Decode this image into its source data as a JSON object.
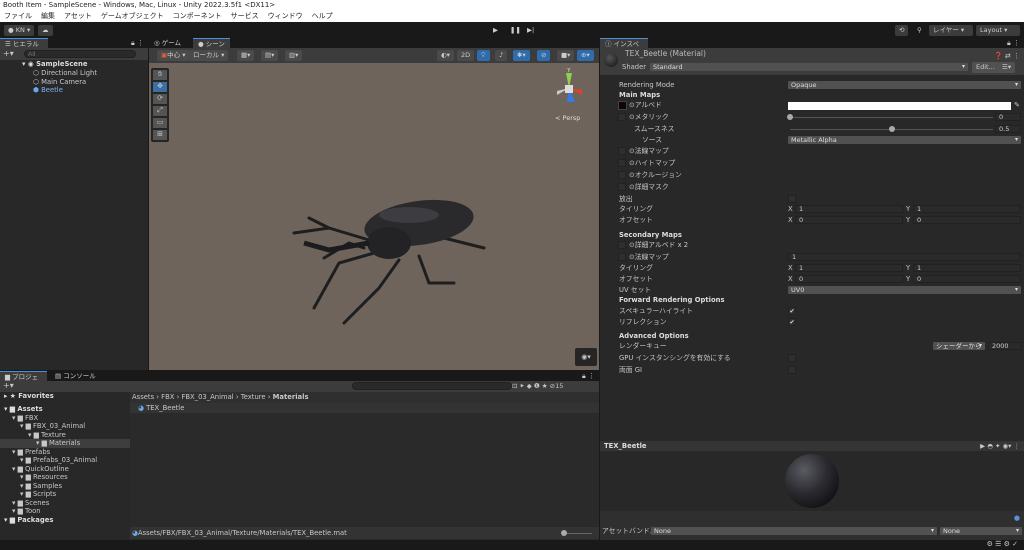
{
  "window": {
    "title": "Booth Item - SampleScene - Windows, Mac, Linux - Unity 2022.3.5f1 <DX11>"
  },
  "menu": [
    "ファイル",
    "編集",
    "アセット",
    "ゲームオブジェクト",
    "コンポーネント",
    "サービス",
    "ウィンドウ",
    "ヘルプ"
  ],
  "toolbar": {
    "account": "KN",
    "layers": "レイヤー",
    "layout": "Layout"
  },
  "hierarchy": {
    "tab": "ヒエラルキー",
    "search_placeholder": "All",
    "scene": "SampleScene",
    "items": [
      "Directional Light",
      "Main Camera",
      "Beetle"
    ]
  },
  "scene_view": {
    "tabs": [
      "ゲーム",
      "シーン"
    ],
    "pivot": "中心",
    "space": "ローカル",
    "mode_2d": "2D",
    "persp": "< Persp",
    "gizmo_y": "Y"
  },
  "inspector": {
    "tab": "インスペクター",
    "material_name": "TEX_Beetle (Material)",
    "shader_label": "Shader",
    "shader": "Standard",
    "edit": "Edit...",
    "rendering_mode_label": "Rendering Mode",
    "rendering_mode": "Opaque",
    "main_maps": "Main Maps",
    "albedo": "アルベド",
    "metallic": "メタリック",
    "metallic_value": "0",
    "smoothness": "スムースネス",
    "smoothness_value": "0.5",
    "smoothness_fraction": 0.5,
    "source": "ソース",
    "source_value": "Metallic Alpha",
    "normal_map": "法線マップ",
    "height_map": "ハイトマップ",
    "occlusion": "オクルージョン",
    "detail_mask": "詳細マスク",
    "emission": "放出",
    "tiling": "タイリング",
    "offset": "オフセット",
    "x": "X",
    "y": "Y",
    "tiling_x": "1",
    "tiling_y": "1",
    "offset_x": "0",
    "offset_y": "0",
    "secondary_maps": "Secondary Maps",
    "detail_albedo": "詳細アルベド x 2",
    "sec_normal_map": "法線マップ",
    "sec_normal_value": "1",
    "sec_tiling_x": "1",
    "sec_tiling_y": "1",
    "sec_offset_x": "0",
    "sec_offset_y": "0",
    "uv_set_label": "UV セット",
    "uv_set": "UV0",
    "forward_options": "Forward Rendering Options",
    "specular": "スペキュラーハイライト",
    "reflections": "リフレクション",
    "advanced": "Advanced Options",
    "render_queue": "レンダーキュー",
    "render_queue_mode": "シェーダーから",
    "render_queue_value": "2000",
    "gpu_instancing": "GPU インスタンシングを有効にする",
    "double_sided_gi": "両面 GI",
    "preview_title": "TEX_Beetle",
    "asset_bundle_label": "アセットバンドル",
    "asset_bundle": "None",
    "asset_variant": "None"
  },
  "project": {
    "tabs": [
      "プロジェクト",
      "コンソール"
    ],
    "hidden_count": "15",
    "tree": [
      {
        "label": "Favorites",
        "depth": 0,
        "bold": true
      },
      {
        "label": "Assets",
        "depth": 0,
        "bold": true
      },
      {
        "label": "FBX",
        "depth": 1
      },
      {
        "label": "FBX_03_Animal",
        "depth": 2
      },
      {
        "label": "Texture",
        "depth": 3
      },
      {
        "label": "Materials",
        "depth": 4,
        "selected": true
      },
      {
        "label": "Prefabs",
        "depth": 1
      },
      {
        "label": "Prefabs_03_Animal",
        "depth": 2
      },
      {
        "label": "QuickOutline",
        "depth": 1
      },
      {
        "label": "Resources",
        "depth": 2
      },
      {
        "label": "Samples",
        "depth": 2
      },
      {
        "label": "Scripts",
        "depth": 2
      },
      {
        "label": "Scenes",
        "depth": 1
      },
      {
        "label": "Toon",
        "depth": 1
      },
      {
        "label": "Packages",
        "depth": 0,
        "bold": true
      }
    ],
    "breadcrumb": [
      "Assets",
      "FBX",
      "FBX_03_Animal",
      "Texture",
      "Materials"
    ],
    "file": "TEX_Beetle",
    "path": "Assets/FBX/FBX_03_Animal/Texture/Materials/TEX_Beetle.mat"
  }
}
